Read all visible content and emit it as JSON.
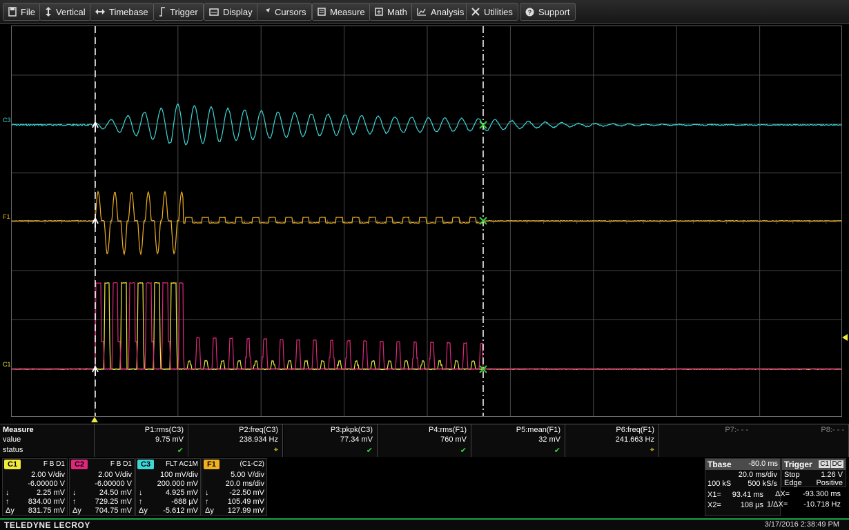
{
  "menu": {
    "file": "File",
    "vertical": "Vertical",
    "timebase": "Timebase",
    "trigger": "Trigger",
    "display": "Display",
    "cursors": "Cursors",
    "measure": "Measure",
    "math": "Math",
    "analysis": "Analysis",
    "utilities": "Utilities",
    "support": "Support"
  },
  "traces": {
    "c3_label": "C3",
    "f1_label": "F1",
    "c1_label": "C1"
  },
  "colors": {
    "c1": "#f0ea3c",
    "c2": "#e0287a",
    "c3": "#3cd8d8",
    "f1": "#f0b020",
    "grid": "#4a4a4a",
    "cursor": "#ffffff"
  },
  "measure": {
    "title": "Measure",
    "value_label": "value",
    "status_label": "status",
    "params": [
      {
        "name": "P1:rms(C3)",
        "value": "9.75 mV",
        "status": "ok"
      },
      {
        "name": "P2:freq(C3)",
        "value": "238.934 Hz",
        "status": "warn"
      },
      {
        "name": "P3:pkpk(C3)",
        "value": "77.34 mV",
        "status": "ok"
      },
      {
        "name": "P4:rms(F1)",
        "value": "760 mV",
        "status": "ok"
      },
      {
        "name": "P5:mean(F1)",
        "value": "32 mV",
        "status": "ok"
      },
      {
        "name": "P6:freq(F1)",
        "value": "241.663 Hz",
        "status": "warn"
      },
      {
        "name": "P7:- - -",
        "value": "",
        "status": ""
      },
      {
        "name": "P8:- - -",
        "value": "",
        "status": ""
      }
    ]
  },
  "channels": [
    {
      "tag": "C1",
      "flags": "F  B  D1",
      "scale": "2.00 V/div",
      "offset": "-6.00000 V",
      "down": "2.25 mV",
      "up": "834.00 mV",
      "dy": "831.75 mV"
    },
    {
      "tag": "C2",
      "flags": "F  B  D1",
      "scale": "2.00 V/div",
      "offset": "-6.00000 V",
      "down": "24.50 mV",
      "up": "729.25 mV",
      "dy": "704.75 mV"
    },
    {
      "tag": "C3",
      "flags": "FLT  AC1M",
      "scale": "100 mV/div",
      "offset": "200.000 mV",
      "down": "4.925 mV",
      "up": "-688 µV",
      "dy": "-5.612 mV"
    },
    {
      "tag": "F1",
      "flags": "(C1-C2)",
      "scale": "5.00 V/div",
      "offset": "20.0 ms/div",
      "down": "-22.50 mV",
      "up": "105.49 mV",
      "dy": "127.99 mV"
    }
  ],
  "timebase": {
    "title": "Tbase",
    "delay": "-80.0 ms",
    "tdiv": "20.0 ms/div",
    "samples": "100 kS",
    "rate": "500 kS/s",
    "x1_label": "X1=",
    "x1": "93.41 ms",
    "dx_label": "ΔX=",
    "dx": "-93.300 ms",
    "x2_label": "X2=",
    "x2": "108 µs",
    "inv_label": "1/ΔX=",
    "inv": "-10.718 Hz"
  },
  "trigger": {
    "title": "Trigger",
    "ch": "C1",
    "coupling": "DC",
    "mode": "Stop",
    "level": "1.26 V",
    "type": "Edge",
    "slope": "Positive"
  },
  "footer": {
    "brand": "TELEDYNE LECROY",
    "datetime": "3/17/2016 2:38:49 PM"
  }
}
